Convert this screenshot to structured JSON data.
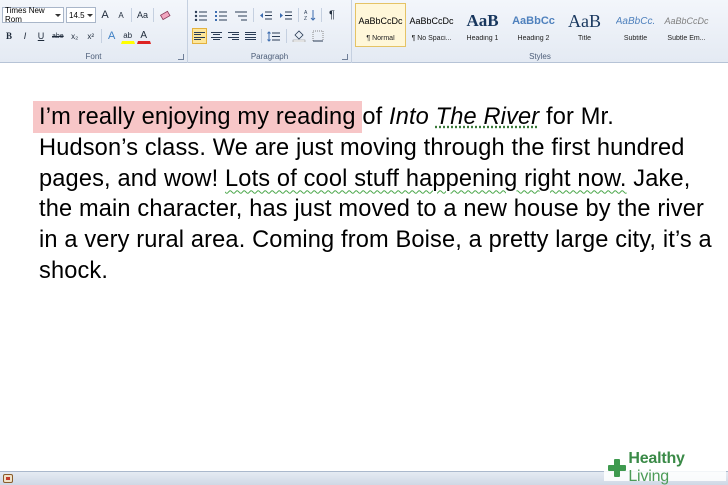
{
  "ribbon": {
    "font_group": {
      "label": "Font",
      "font_name": "Times New Rom",
      "font_size": "14.5",
      "grow_font": "A",
      "shrink_font": "A",
      "change_case": "Aa",
      "bold": "B",
      "italic": "I",
      "underline": "U",
      "strikethrough": "abe",
      "subscript": "x₂",
      "superscript": "x²",
      "text_effects": "A",
      "highlight": "ab",
      "font_color": "A"
    },
    "paragraph_group": {
      "label": "Paragraph",
      "show_marks": "¶"
    },
    "styles_group": {
      "label": "Styles",
      "styles": [
        {
          "preview": "AaBbCcDc",
          "name": "¶ Normal"
        },
        {
          "preview": "AaBbCcDc",
          "name": "¶ No Spaci..."
        },
        {
          "preview": "AaB",
          "name": "Heading 1"
        },
        {
          "preview": "AaBbCc",
          "name": "Heading 2"
        },
        {
          "preview": "AaB",
          "name": "Title"
        },
        {
          "preview": "AaBbCc.",
          "name": "Subtitle"
        },
        {
          "preview": "AaBbCcDc",
          "name": "Subtle Em..."
        }
      ]
    }
  },
  "document": {
    "highlighted": "I’m really enjoying my reading",
    "text_a": " of ",
    "title_part1": "Into ",
    "title_part2": "The River",
    "text_b": " for Mr. Hudson’s class. We are just moving through the first hundred pages, and wow! ",
    "grammar_flagged": "Lots of cool stuff happening right now.",
    "text_c": " Jake, the main character, has just moved to a new house by the river in a very rural area. Coming from Boise, a pretty large city, it’s a shock."
  },
  "watermark": {
    "bold": "Healthy",
    "light": "Living"
  },
  "colors": {
    "highlight": "#f7c6c7",
    "grammar_underline": "#48a648",
    "ribbon_bg": "#e4eaf3",
    "watermark_green": "#3a8a47"
  }
}
